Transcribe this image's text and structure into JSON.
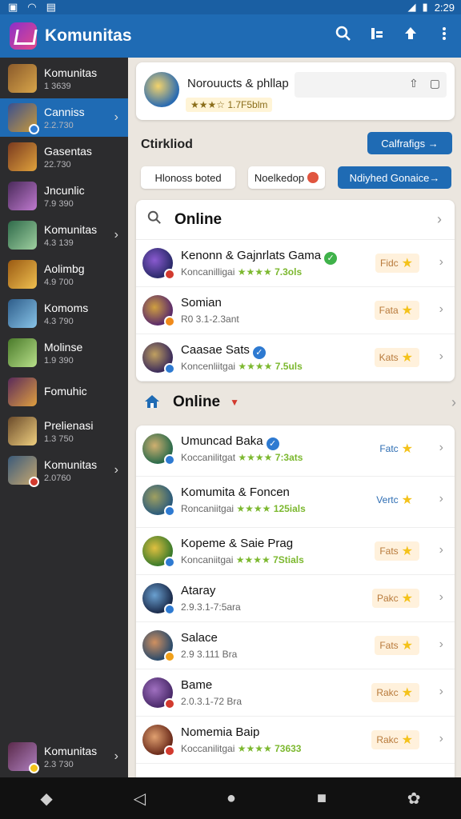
{
  "status": {
    "time": "2:29"
  },
  "appbar": {
    "title": "Komunitas"
  },
  "sidebar": {
    "items": [
      {
        "title": "Komunitas",
        "sub": "1 3639",
        "colors": [
          "#8a5a2b",
          "#d9a64a"
        ],
        "chevron": false
      },
      {
        "title": "Canniss",
        "sub": "2.2.730",
        "colors": [
          "#3a4f8f",
          "#c99a3a"
        ],
        "chevron": true,
        "active": true,
        "badge": "#2e7ad1"
      },
      {
        "title": "Gasentas",
        "sub": "22.730",
        "colors": [
          "#7a3a1f",
          "#e0a23c"
        ],
        "chevron": false
      },
      {
        "title": "Jncunlic",
        "sub": "7.9 390",
        "colors": [
          "#4a2a5a",
          "#c07ad0"
        ],
        "chevron": false
      },
      {
        "title": "Komunitas",
        "sub": "4.3 139",
        "colors": [
          "#2f6a4a",
          "#9fd0a0"
        ],
        "chevron": true
      },
      {
        "title": "Aolimbg",
        "sub": "4.9 700",
        "colors": [
          "#9a5a12",
          "#f0c050"
        ],
        "chevron": false
      },
      {
        "title": "Komoms",
        "sub": "4.3 790",
        "colors": [
          "#2e5d8a",
          "#88c4e8"
        ],
        "chevron": false
      },
      {
        "title": "Molinse",
        "sub": "1.9 390",
        "colors": [
          "#4a7a2a",
          "#b8e08a"
        ],
        "chevron": false
      },
      {
        "title": "Fomuhic",
        "sub": "",
        "colors": [
          "#5a2a5a",
          "#e0a040"
        ],
        "chevron": false
      },
      {
        "title": "Prelienasi",
        "sub": "1.3 750",
        "colors": [
          "#6a4a2a",
          "#f0d080"
        ],
        "chevron": false
      },
      {
        "title": "Komunitas",
        "sub": "2.0760",
        "colors": [
          "#3a5a7a",
          "#c8a870"
        ],
        "chevron": true,
        "badge": "#d23a2e"
      }
    ],
    "bottom": {
      "title": "Komunitas",
      "sub": "2.3 730",
      "colors": [
        "#5a2a4a",
        "#b080c0"
      ],
      "chevron": true,
      "badge": "#f4c21a"
    }
  },
  "hero": {
    "title": "Norouucts & phllap",
    "rating": "★★★☆ 1.7F5blm"
  },
  "filters": {
    "heading": "Ctirkliod",
    "cta": "Calfrafigs →",
    "pill1": "Hlonoss boted",
    "pill2": "Noelkedop",
    "pill3": "Ndiyhed Gonaice→"
  },
  "online1": {
    "label": "Online",
    "rows": [
      {
        "name": "Kenonn & Gajnrlats Gama",
        "sub_prefix": "Koncanilligai",
        "stars": "★★★★",
        "sub_suffix": "7.3ols",
        "tag": "Fidc",
        "plain": false,
        "av": [
          "#2a2a6a",
          "#8a5ad0"
        ],
        "dot": "#d23a2e",
        "verified": "#3fb24a"
      },
      {
        "name": "Somian",
        "sub_prefix": "R0 3.1-2.3ant",
        "stars": "",
        "sub_suffix": "",
        "tag": "Fata",
        "plain": false,
        "av": [
          "#5a2a6a",
          "#d0a040"
        ],
        "dot": "#f08a1a"
      },
      {
        "name": "Caasae Sats",
        "sub_prefix": "Koncenliitgai",
        "stars": "★★★★",
        "sub_suffix": "7.5uls",
        "tag": "Kats",
        "plain": false,
        "av": [
          "#3a2a5a",
          "#c0a060"
        ],
        "dot": "#2e7ad1",
        "verified": "#2e7ad1"
      }
    ]
  },
  "online2": {
    "label": "Online",
    "rows": [
      {
        "name": "Umuncad Baka",
        "sub_prefix": "Koccanilitgat",
        "stars": "★★★★",
        "sub_suffix": "7:3ats",
        "tag": "Fatc",
        "plain": true,
        "av": [
          "#2a6a4a",
          "#d0b070"
        ],
        "dot": "#2e7ad1",
        "verified": "#2e7ad1"
      },
      {
        "name": "Komumita & Foncen",
        "sub_prefix": "Roncaniitgai",
        "stars": "★★★★",
        "sub_suffix": "125ials",
        "tag": "Vertc",
        "plain": true,
        "av": [
          "#2a5a7a",
          "#a0a060"
        ],
        "dot": "#2e7ad1"
      },
      {
        "name": "Kopeme & Saie Prag",
        "sub_prefix": "Koncaniitgai",
        "stars": "★★★★",
        "sub_suffix": "7Stials",
        "tag": "Fats",
        "plain": false,
        "av": [
          "#3a7a2a",
          "#e0c040"
        ],
        "dot": "#2e7ad1"
      },
      {
        "name": "Ataray",
        "sub_prefix": "2.9.3.1-7:5ara",
        "stars": "",
        "sub_suffix": "",
        "tag": "Pakc",
        "plain": false,
        "av": [
          "#1a2a4a",
          "#6aa0d0"
        ],
        "dot": "#2e7ad1"
      },
      {
        "name": "Salace",
        "sub_prefix": "2.9 3.111 Bra",
        "stars": "",
        "sub_suffix": "",
        "tag": "Fats",
        "plain": false,
        "av": [
          "#2a4a6a",
          "#d09060"
        ],
        "dot": "#f0a01a"
      },
      {
        "name": "Bame",
        "sub_prefix": "2.0.3.1-72 Bra",
        "stars": "",
        "sub_suffix": "",
        "tag": "Rakc",
        "plain": false,
        "av": [
          "#4a2a6a",
          "#a070c0"
        ],
        "dot": "#d23a2e"
      },
      {
        "name": "Nomemia Baip",
        "sub_prefix": "Koccanilitgai",
        "stars": "★★★★",
        "sub_suffix": "73633",
        "tag": "Rakc",
        "plain": false,
        "av": [
          "#6a2a1a",
          "#e0a070"
        ],
        "dot": "#d23a2e"
      }
    ]
  },
  "colors": {
    "primary": "#1f6bb4",
    "sidebar": "#2c2c2e",
    "accent_star": "#f4c21a",
    "rating_green": "#7cb82f"
  }
}
